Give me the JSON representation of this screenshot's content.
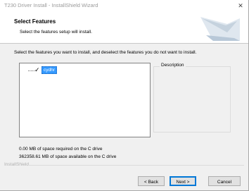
{
  "window": {
    "title": "T230 Driver Install - InstallShield Wizard",
    "close_glyph": "✕"
  },
  "header": {
    "title": "Select Features",
    "subtitle": "Select the features setup will install.",
    "graphic_icon": "installshield-banner-graphic"
  },
  "body": {
    "instructions": "Select the features you want to install, and deselect the features you do not want to install."
  },
  "feature_tree": {
    "items": [
      {
        "label": "cydhr",
        "checked": true,
        "selected": true
      }
    ]
  },
  "description": {
    "label": "Description",
    "text": ""
  },
  "disk": {
    "required": "0.00 MB of space required on the C drive",
    "available": "362358.61 MB of space available on the C drive"
  },
  "footer": {
    "brand": "InstallShield",
    "back_label": "< Back",
    "next_label": "Next >",
    "cancel_label": "Cancel"
  },
  "colors": {
    "selection": "#3399ff",
    "default_button_border": "#0078d7"
  }
}
